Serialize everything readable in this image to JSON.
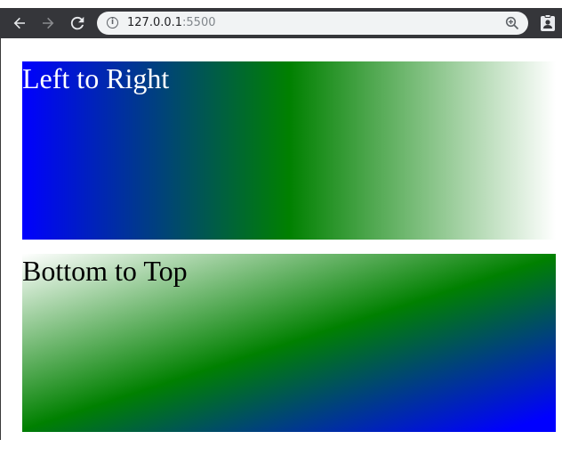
{
  "browser": {
    "url_host": "127.0.0.1",
    "url_port": ":5500",
    "back_icon": "arrow-left",
    "forward_icon": "arrow-right",
    "reload_icon": "reload",
    "info_icon": "info",
    "zoom_icon": "magnifier-plus",
    "profile_icon": "clipboard-user"
  },
  "page": {
    "boxes": [
      {
        "label": "Left to Right",
        "gradient": [
          "#0000ff",
          "#008000",
          "#ffffff"
        ],
        "direction": "to right"
      },
      {
        "label": "Bottom to Top",
        "gradient": [
          "#0000ff",
          "#008000",
          "#ffffff"
        ],
        "direction": "to top"
      }
    ]
  }
}
